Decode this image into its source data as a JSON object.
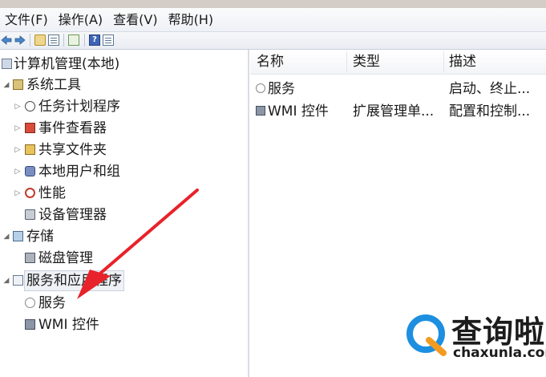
{
  "menubar": {
    "items": [
      "文件(F)",
      "操作(A)",
      "查看(V)",
      "帮助(H)"
    ]
  },
  "toolbar": {
    "buttons": [
      "back-icon",
      "forward-icon",
      "up-one-level-icon",
      "show-hide-console-tree-icon",
      "export-list-icon",
      "help-icon",
      "show-hide-action-pane-icon"
    ]
  },
  "tree": {
    "root": {
      "label": "计算机管理(本地)",
      "icon": "computer-management-icon"
    },
    "system_tools": {
      "label": "系统工具",
      "icon": "system-tools-icon"
    },
    "task_scheduler": {
      "label": "任务计划程序",
      "icon": "clock-icon"
    },
    "event_viewer": {
      "label": "事件查看器",
      "icon": "event-viewer-icon"
    },
    "shared_folders": {
      "label": "共享文件夹",
      "icon": "shared-folder-icon"
    },
    "local_users": {
      "label": "本地用户和组",
      "icon": "users-icon"
    },
    "performance": {
      "label": "性能",
      "icon": "performance-icon"
    },
    "device_manager": {
      "label": "设备管理器",
      "icon": "device-manager-icon"
    },
    "storage": {
      "label": "存储",
      "icon": "storage-icon"
    },
    "disk_management": {
      "label": "磁盘管理",
      "icon": "disk-icon"
    },
    "services_apps": {
      "label": "服务和应用程序",
      "icon": "services-applications-icon"
    },
    "services": {
      "label": "服务",
      "icon": "services-icon"
    },
    "wmi": {
      "label": "WMI 控件",
      "icon": "wmi-icon"
    }
  },
  "list": {
    "columns": [
      "名称",
      "类型",
      "描述"
    ],
    "rows": [
      {
        "name": "服务",
        "type": "",
        "description": "启动、终止..."
      },
      {
        "name": "WMI 控件",
        "type": "扩展管理单...",
        "description": "配置和控制..."
      }
    ]
  },
  "watermark": {
    "title": "查询啦",
    "url": "chaxunla.com"
  },
  "colors": {
    "arrow": "#e8222a",
    "logo_blue": "#1d8fe0",
    "logo_orange": "#f39b21"
  }
}
